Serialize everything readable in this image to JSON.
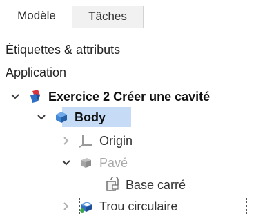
{
  "tabs": [
    {
      "label": "Modèle",
      "active": true
    },
    {
      "label": "Tâches",
      "active": false
    }
  ],
  "sections": {
    "labels_attributes": "Étiquettes & attributs",
    "application": "Application"
  },
  "tree": [
    {
      "label": "Exercice 2 Créer une cavité",
      "icon": "part-document-icon",
      "expanded": true
    },
    {
      "label": "Body",
      "icon": "body-icon",
      "expanded": true,
      "selected": true
    },
    {
      "label": "Origin",
      "icon": "origin-axes-icon",
      "expanded": false
    },
    {
      "label": "Pavé",
      "icon": "pad-icon",
      "expanded": true,
      "dimmed": true
    },
    {
      "label": "Base carré",
      "icon": "sketch-icon"
    },
    {
      "label": "Trou circulaire",
      "icon": "pocket-icon",
      "expanded": false,
      "focused": true
    }
  ],
  "colors": {
    "selection": "#c6dcf6",
    "body_icon": "#3f86d6",
    "part_icon_red": "#d9333b",
    "part_icon_blue": "#2f6fc4"
  }
}
